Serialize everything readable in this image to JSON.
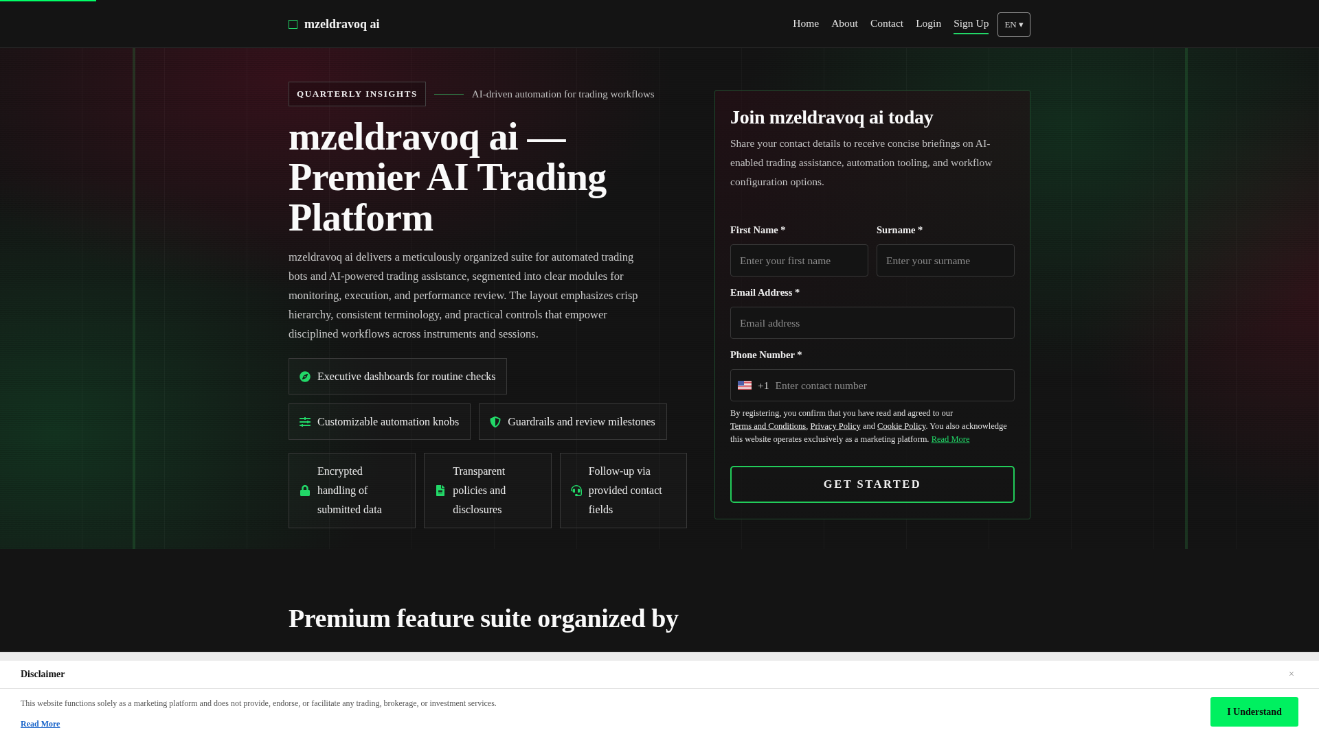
{
  "nav": {
    "brand": "mzeldravoq ai",
    "links": [
      {
        "label": "Home",
        "selected": false
      },
      {
        "label": "About",
        "selected": false
      },
      {
        "label": "Contact",
        "selected": false
      },
      {
        "label": "Login",
        "selected": false
      },
      {
        "label": "Sign Up",
        "selected": true
      }
    ],
    "language": "EN ▾"
  },
  "hero": {
    "badge": "QUARTERLY INSIGHTS",
    "tagline": "AI-driven automation for trading workflows",
    "title": "mzeldravoq ai — Premier AI Trading Platform",
    "description": "mzeldravoq ai delivers a meticulously organized suite for automated trading bots and AI-powered trading assistance, segmented into clear modules for monitoring, execution, and performance review. The layout emphasizes crisp hierarchy, consistent terminology, and practical controls that empower disciplined workflows across instruments and sessions.",
    "highlights": [
      "Executive dashboards for routine checks",
      "Customizable automation knobs",
      "Guardrails and review milestones"
    ],
    "assurances": [
      "Encrypted handling of submitted data",
      "Transparent policies and disclosures",
      "Follow-up via provided contact fields"
    ]
  },
  "form": {
    "title": "Join mzeldravoq ai today",
    "description": "Share your contact details to receive concise briefings on AI-enabled trading assistance, automation tooling, and workflow configuration options.",
    "fields": [
      {
        "kind": "text",
        "label": "First Name *",
        "placeholder": "Enter your first name"
      },
      {
        "kind": "text",
        "label": "Surname *",
        "placeholder": "Enter your surname"
      },
      {
        "kind": "email",
        "label": "Email Address *",
        "placeholder": "Email address"
      },
      {
        "kind": "phone",
        "label": "Phone Number *",
        "dial_code": "+1",
        "placeholder": "Enter contact number"
      }
    ],
    "consent": [
      {
        "kind": "text",
        "text": "By registering, you confirm that you have read and agreed to our "
      },
      {
        "kind": "link",
        "text": "Terms and Conditions"
      },
      {
        "kind": "text",
        "text": ", "
      },
      {
        "kind": "link",
        "text": "Privacy Policy"
      },
      {
        "kind": "text",
        "text": " and "
      },
      {
        "kind": "link",
        "text": "Cookie Policy"
      },
      {
        "kind": "text",
        "text": ". You also acknowledge this website operates exclusively as a marketing platform. "
      },
      {
        "kind": "accent_link",
        "text": "Read More"
      }
    ],
    "submit": "GET STARTED"
  },
  "features": {
    "title": "Premium feature suite organized by"
  },
  "disclaimer": {
    "title": "Disclaimer",
    "close": "×",
    "text": "This website functions solely as a marketing platform and does not provide, endorse, or facilitate any trading, brokerage, or investment services.",
    "link": "Read More",
    "button": "I Understand"
  }
}
